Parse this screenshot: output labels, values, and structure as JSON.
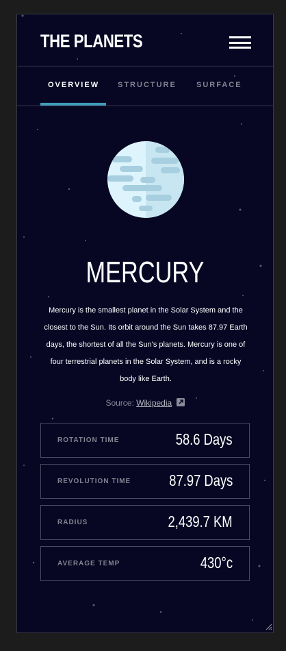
{
  "header": {
    "logo": "THE PLANETS",
    "menu_icon": "hamburger-menu-icon"
  },
  "tabs": [
    {
      "label": "OVERVIEW",
      "active": true
    },
    {
      "label": "STRUCTURE",
      "active": false
    },
    {
      "label": "SURFACE",
      "active": false
    }
  ],
  "planet": {
    "name": "MERCURY",
    "description": "Mercury is the smallest planet in the Solar System and the closest to the Sun. Its orbit around the Sun takes 87.97 Earth days, the shortest of all the Sun's planets. Mercury is one of four terrestrial planets in the Solar System, and is a rocky body like Earth.",
    "source_prefix": "Source:",
    "source_link": "Wikipedia",
    "image_icon": "mercury-planet-icon"
  },
  "stats": [
    {
      "label": "ROTATION TIME",
      "value": "58.6 Days"
    },
    {
      "label": "REVOLUTION TIME",
      "value": "87.97 Days"
    },
    {
      "label": "RADIUS",
      "value": "2,439.7 KM"
    },
    {
      "label": "AVERAGE TEMP",
      "value": "430°c"
    }
  ],
  "colors": {
    "background": "#070724",
    "accent": "#419ebb",
    "border": "#38384f",
    "planet": "#def4fc"
  }
}
